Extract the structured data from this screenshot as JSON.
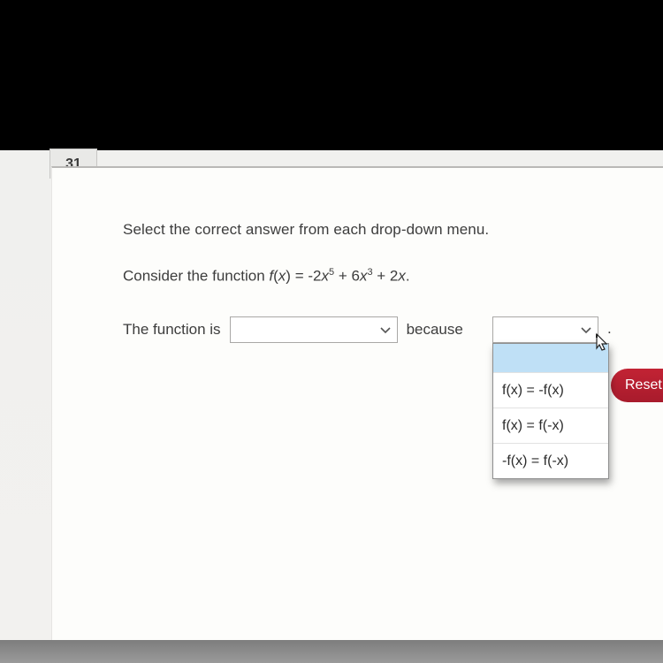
{
  "question_number": "31",
  "instruction": "Select the correct answer from each drop-down menu.",
  "prompt": {
    "prefix": "Consider the function ",
    "function_var": "f",
    "arg_var": "x",
    "eq": "= -2",
    "sup1": "5",
    "plus1": " + 6",
    "sup2": "3",
    "plus2": " + 2",
    "suffix": "."
  },
  "sentence": {
    "label": "The function is",
    "because": "because",
    "period": "."
  },
  "dropdown1": {
    "value": ""
  },
  "dropdown2": {
    "value": "",
    "options": [
      "",
      "f(x) = -f(x)",
      "f(x) = f(-x)",
      "-f(x) = f(-x)"
    ]
  },
  "buttons": {
    "reset": "Reset"
  }
}
